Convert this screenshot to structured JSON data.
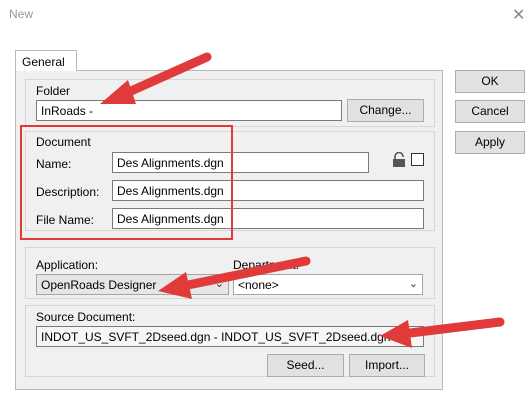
{
  "window": {
    "title": "New",
    "close_glyph": "✕"
  },
  "tabs": [
    {
      "label": "General"
    }
  ],
  "folder": {
    "label": "Folder",
    "value": "InRoads -",
    "change_label": "Change..."
  },
  "document": {
    "label": "Document",
    "name_label": "Name:",
    "name_value": "Des Alignments.dgn",
    "description_label": "Description:",
    "description_value": "Des Alignments.dgn",
    "filename_label": "File Name:",
    "filename_value": "Des Alignments.dgn"
  },
  "application": {
    "label": "Application:",
    "value": "OpenRoads Designer"
  },
  "department": {
    "label": "Department:",
    "value": "<none>"
  },
  "source": {
    "label": "Source Document:",
    "value": "INDOT_US_SVFT_2Dseed.dgn - INDOT_US_SVFT_2Dseed.dgn",
    "seed_label": "Seed...",
    "import_label": "Import..."
  },
  "actions": {
    "ok_label": "OK",
    "cancel_label": "Cancel",
    "apply_label": "Apply"
  },
  "colors": {
    "annotation_red": "#e03a3a",
    "panel_bg": "#f0f0f0"
  },
  "icons": [
    "lock-icon",
    "chevron-down-icon",
    "close-icon"
  ]
}
